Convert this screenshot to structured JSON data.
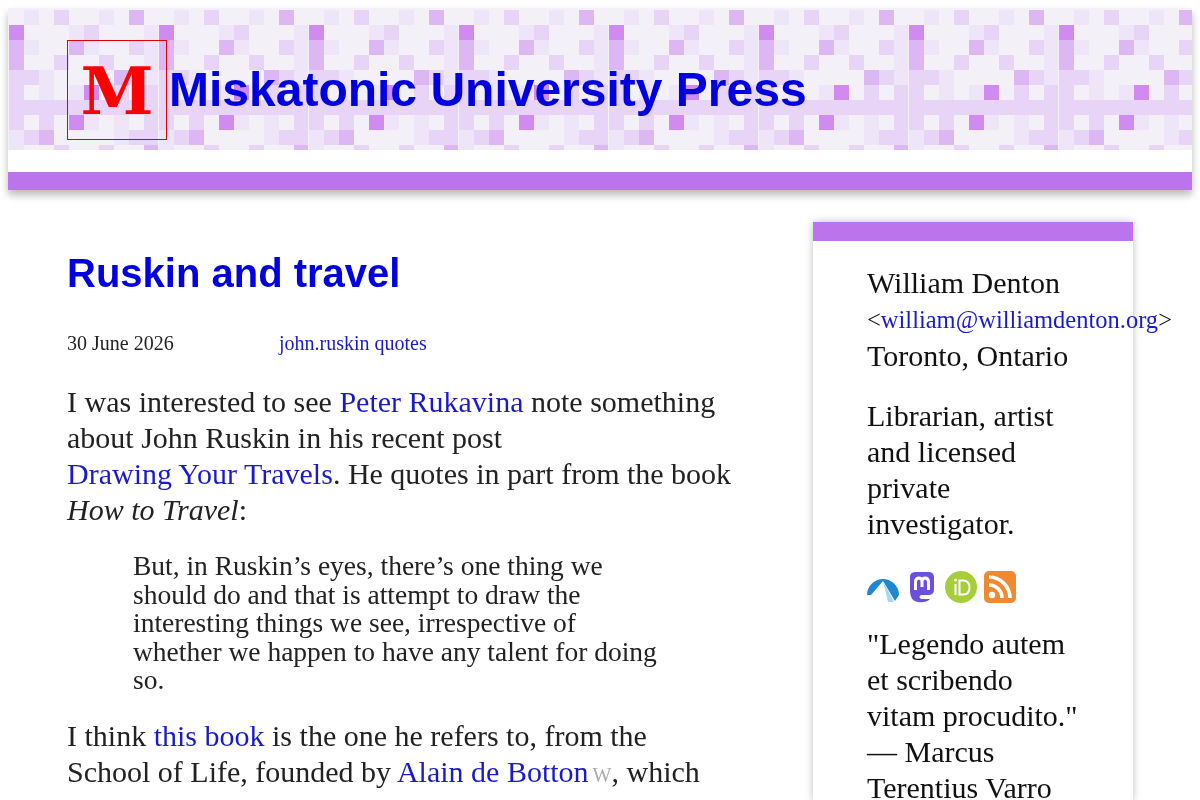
{
  "header": {
    "logo_letter": "M",
    "site_title": "Miskatonic University Press"
  },
  "post": {
    "title": "Ruskin and travel",
    "date": "30 June 2026",
    "tags": [
      "john.ruskin",
      "quotes"
    ],
    "body": [
      {
        "kind": "paragraph",
        "segments": [
          {
            "kind": "text",
            "text": "I was interested to see "
          },
          {
            "kind": "link",
            "text": "Peter Rukavina"
          },
          {
            "kind": "text",
            "text": " note something about John Ruskin in his recent post "
          },
          {
            "kind": "link",
            "text": "Drawing Your Travels"
          },
          {
            "kind": "text",
            "text": ". He quotes in part from the book *How to Travel*:"
          }
        ]
      },
      {
        "kind": "blockquote",
        "text": "But, in Ruskin’s eyes, there’s one thing we should do and that is attempt to draw the interesting things we see, irrespective of whether we happen to have any talent for doing so."
      },
      {
        "kind": "paragraph",
        "segments": [
          {
            "kind": "text",
            "text": "I think "
          },
          {
            "kind": "link",
            "text": "this book"
          },
          {
            "kind": "text",
            "text": " is the one he refers to, from the School of Life, founded by "
          },
          {
            "kind": "link",
            "text": "Alain de Botton"
          },
          {
            "kind": "mark_link",
            "text": "W"
          },
          {
            "kind": "text",
            "text": ", which"
          }
        ]
      }
    ]
  },
  "sidebar": {
    "name": "William Denton",
    "email_open": "<",
    "email": "william@williamdenton.org",
    "email_close": ">",
    "location": "Toronto, Ontario",
    "bio": "Librarian, artist and licensed private investigator.",
    "quote": "\"Legendo autem et scribendo vitam procudito.\" — Marcus Terentius Varro"
  }
}
